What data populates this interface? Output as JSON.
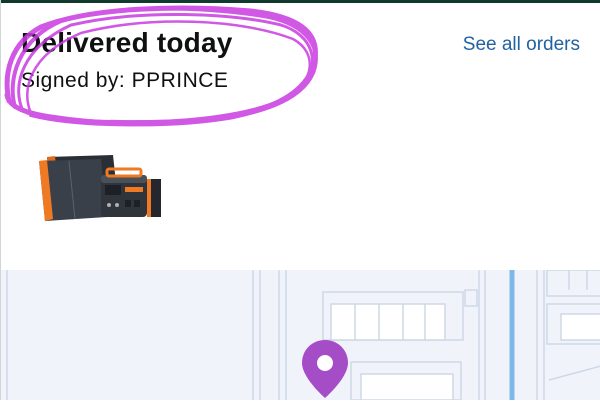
{
  "delivery": {
    "title": "Delivered today",
    "signed_by": "Signed by: PPRINCE",
    "see_all_orders": "See all orders"
  },
  "product": {
    "image": "portable power station with folding solar panels"
  },
  "map": {
    "pin_icon": "location-pin-icon",
    "pin_color": "#a54cc7"
  },
  "colors": {
    "highlight_scribble": "#c83be0",
    "link": "#2162a1",
    "title_text": "#0f1111"
  }
}
